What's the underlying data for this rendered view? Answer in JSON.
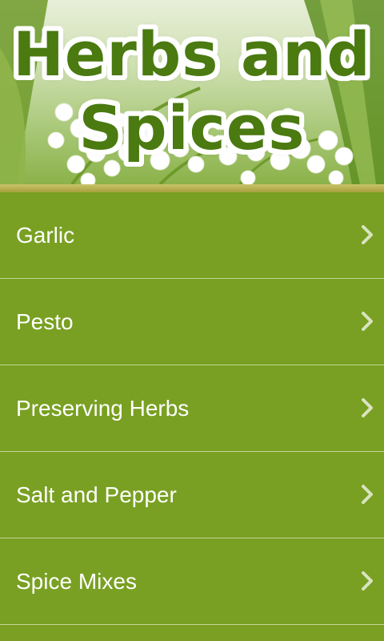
{
  "header": {
    "title_line1": "Herbs and",
    "title_line2": "Spices"
  },
  "menu": {
    "items": [
      {
        "label": "Garlic",
        "icon": "chevron-right-icon"
      },
      {
        "label": "Pesto",
        "icon": "chevron-right-icon"
      },
      {
        "label": "Preserving Herbs",
        "icon": "chevron-right-icon"
      },
      {
        "label": "Salt and Pepper",
        "icon": "chevron-right-icon"
      },
      {
        "label": "Spice Mixes",
        "icon": "chevron-right-icon"
      }
    ]
  },
  "colors": {
    "list_background": "#79a022",
    "title_text": "#4a7a10",
    "title_outline": "#ffffff",
    "divider": "#c4d69a",
    "accent_bar": "#b3ab48"
  }
}
